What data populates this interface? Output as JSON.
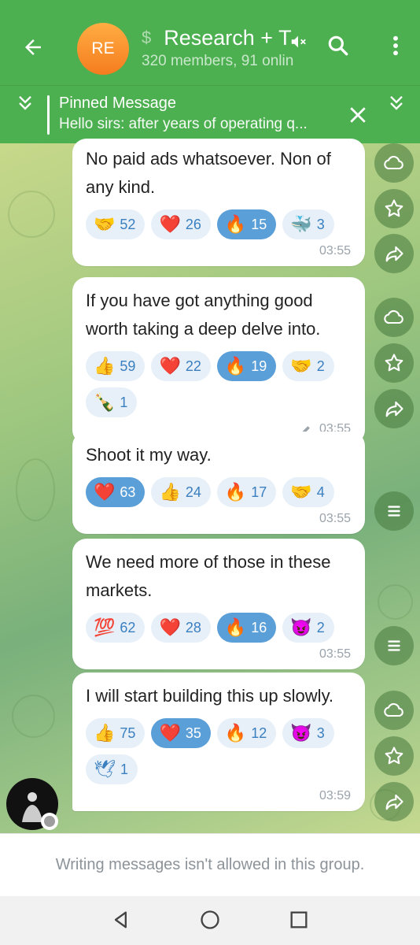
{
  "header": {
    "avatar_initials": "RE",
    "title_prefix": "$",
    "title": "Research + T",
    "subtitle": "320 members, 91 onlin",
    "accent": "#4caf50"
  },
  "pinned": {
    "title": "Pinned Message",
    "text": "Hello sirs: after years of operating q..."
  },
  "messages": [
    {
      "text": "No paid ads whatsoever. Non of any kind.",
      "reactions": [
        {
          "emoji": "🤝",
          "count": "52",
          "active": false
        },
        {
          "emoji": "❤️",
          "count": "26",
          "active": false
        },
        {
          "emoji": "🔥",
          "count": "15",
          "active": true
        },
        {
          "emoji": "🐳",
          "count": "3",
          "active": false
        }
      ],
      "time": "03:55",
      "edited": false
    },
    {
      "text": "If you have got anything good worth taking a deep delve into.",
      "reactions": [
        {
          "emoji": "👍",
          "count": "59",
          "active": false
        },
        {
          "emoji": "❤️",
          "count": "22",
          "active": false
        },
        {
          "emoji": "🔥",
          "count": "19",
          "active": true
        },
        {
          "emoji": "🤝",
          "count": "2",
          "active": false
        },
        {
          "emoji": "🍾",
          "count": "1",
          "active": false
        }
      ],
      "time": "03:55",
      "edited": true
    },
    {
      "text": "Shoot it my way.",
      "reactions": [
        {
          "emoji": "❤️",
          "count": "63",
          "active": true
        },
        {
          "emoji": "👍",
          "count": "24",
          "active": false
        },
        {
          "emoji": "🔥",
          "count": "17",
          "active": false
        },
        {
          "emoji": "🤝",
          "count": "4",
          "active": false
        }
      ],
      "time": "03:55",
      "edited": false
    },
    {
      "text": "We need more of those in these markets.",
      "reactions": [
        {
          "emoji": "💯",
          "count": "62",
          "active": false
        },
        {
          "emoji": "❤️",
          "count": "28",
          "active": false
        },
        {
          "emoji": "🔥",
          "count": "16",
          "active": true
        },
        {
          "emoji": "😈",
          "count": "2",
          "active": false
        }
      ],
      "time": "03:55",
      "edited": false
    },
    {
      "text": "I will start building this up slowly.",
      "reactions": [
        {
          "emoji": "👍",
          "count": "75",
          "active": false
        },
        {
          "emoji": "❤️",
          "count": "35",
          "active": true
        },
        {
          "emoji": "🔥",
          "count": "12",
          "active": false
        },
        {
          "emoji": "😈",
          "count": "3",
          "active": false
        },
        {
          "emoji": "🕊",
          "count": "1",
          "active": false
        }
      ],
      "time": "03:59",
      "edited": false
    }
  ],
  "footer": {
    "notice": "Writing messages isn't allowed in this group."
  }
}
